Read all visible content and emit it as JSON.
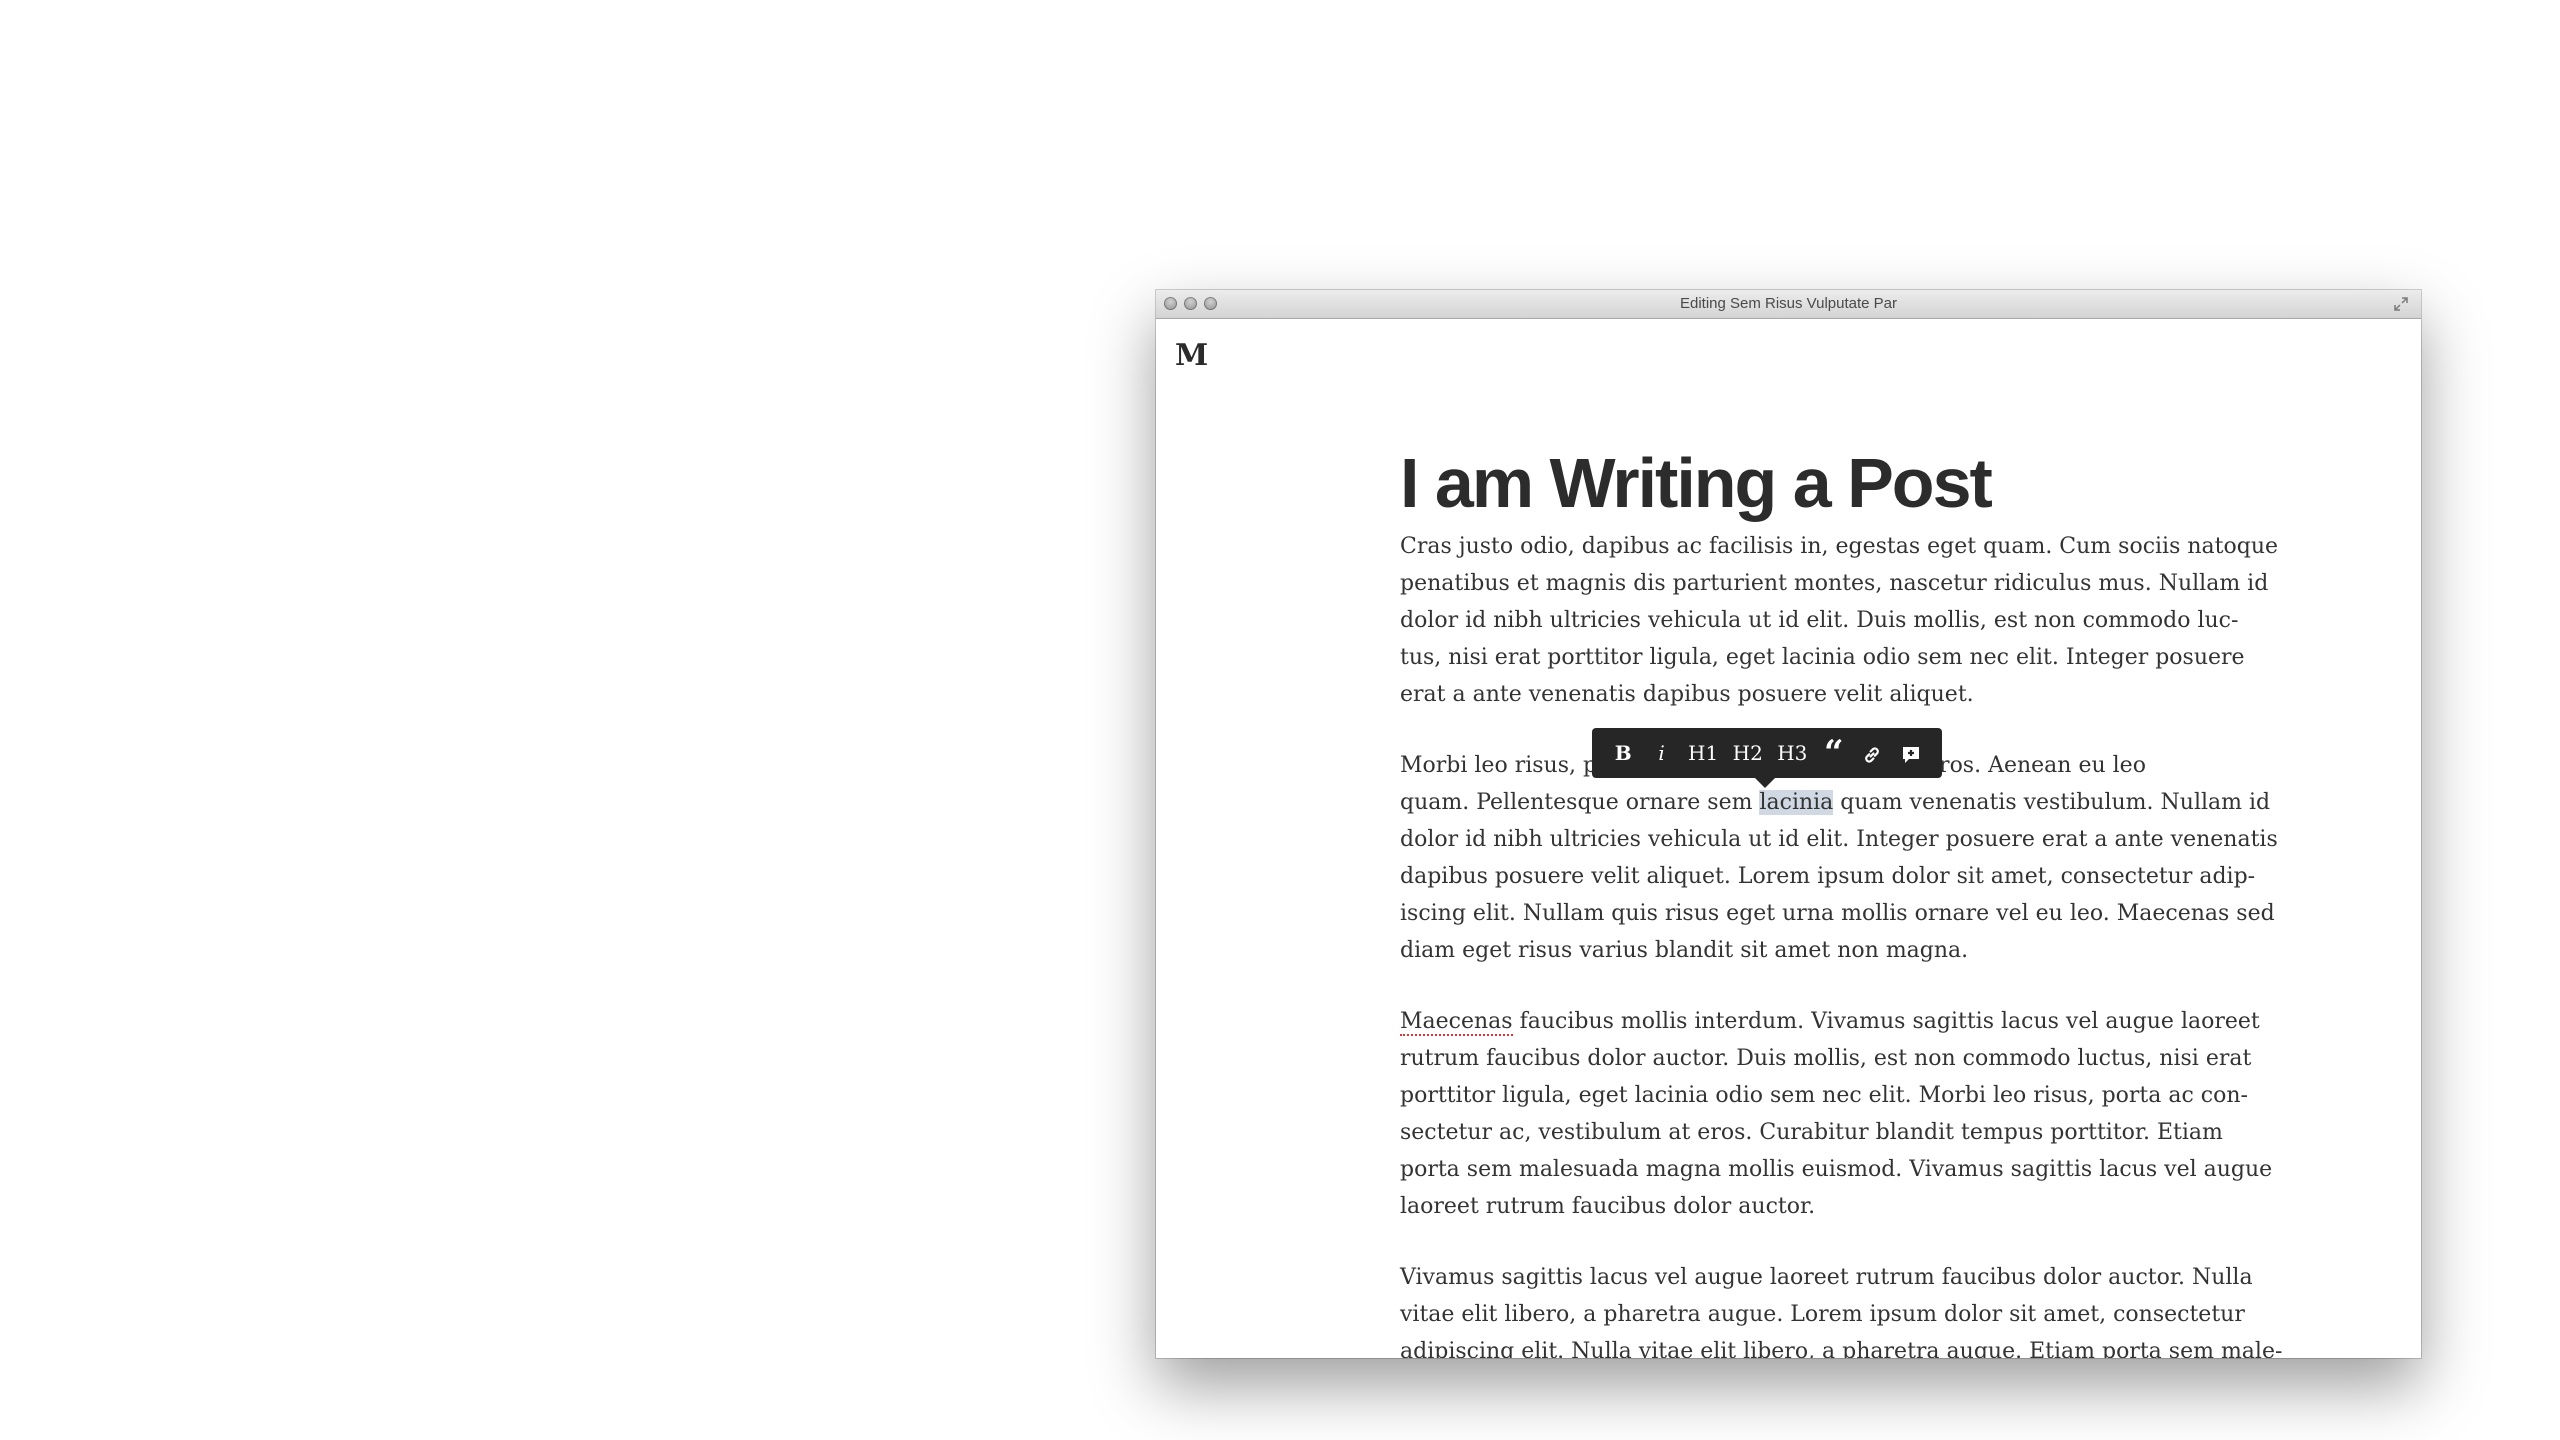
{
  "window": {
    "title": "Editing Sem Risus Vulputate Par"
  },
  "app": {
    "logo": "M"
  },
  "post": {
    "title": "I am Writing a Post",
    "paragraphs": [
      {
        "lines": [
          "Cras justo odio, dapibus ac facilisis in, egestas eget quam. Cum sociis natoque",
          "penatibus et magnis dis parturient montes, nascetur ridiculus mus. Nullam id",
          "dolor id nibh ultricies vehicula ut id elit. Duis mollis, est non commodo luc-",
          "tus, nisi erat porttitor ligula, eget lacinia odio sem nec elit. Integer posuere",
          "erat a ante venenatis dapibus posuere velit aliquet."
        ]
      },
      {
        "line1_start": "Morbi leo risus, p",
        "line1_end": "at eros. Aenean eu leo",
        "line2_before": "quam. Pellentesque ornare sem ",
        "selected_word": "lacinia",
        "line2_after": " quam venenatis vestibulum. Nullam id",
        "lines": [
          "dolor id nibh ultricies vehicula ut id elit. Integer posuere erat a ante venenatis",
          "dapibus posuere velit aliquet. Lorem ipsum dolor sit amet, consectetur adip-",
          "iscing elit. Nullam quis risus eget urna mollis ornare vel eu leo. Maecenas sed",
          "diam eget risus varius blandit sit amet non magna."
        ]
      },
      {
        "misspelled_word": "Maecenas",
        "line1_rest": " faucibus mollis interdum. Vivamus sagittis lacus vel augue laoreet",
        "lines": [
          "rutrum faucibus dolor auctor. Duis mollis, est non commodo luctus, nisi erat",
          "porttitor ligula, eget lacinia odio sem nec elit. Morbi leo risus, porta ac con-",
          "sectetur ac, vestibulum at eros. Curabitur blandit tempus porttitor. Etiam",
          "porta sem malesuada magna mollis euismod. Vivamus sagittis lacus vel augue",
          "laoreet rutrum faucibus dolor auctor."
        ]
      },
      {
        "lines": [
          "Vivamus sagittis lacus vel augue laoreet rutrum faucibus dolor auctor. Nulla",
          "vitae elit libero, a pharetra augue. Lorem ipsum dolor sit amet, consectetur",
          "adipiscing elit. Nulla vitae elit libero, a pharetra augue. Etiam porta sem male-"
        ]
      }
    ]
  },
  "toolbar": {
    "bold": "B",
    "italic": "i",
    "h1": "H1",
    "h2": "H2",
    "h3": "H3",
    "quote": "“",
    "link_icon": "link-icon",
    "comment_icon": "comment-icon"
  },
  "colors": {
    "toolbar_bg": "#262626",
    "selection": "#cfd8e3",
    "text": "#333333"
  }
}
